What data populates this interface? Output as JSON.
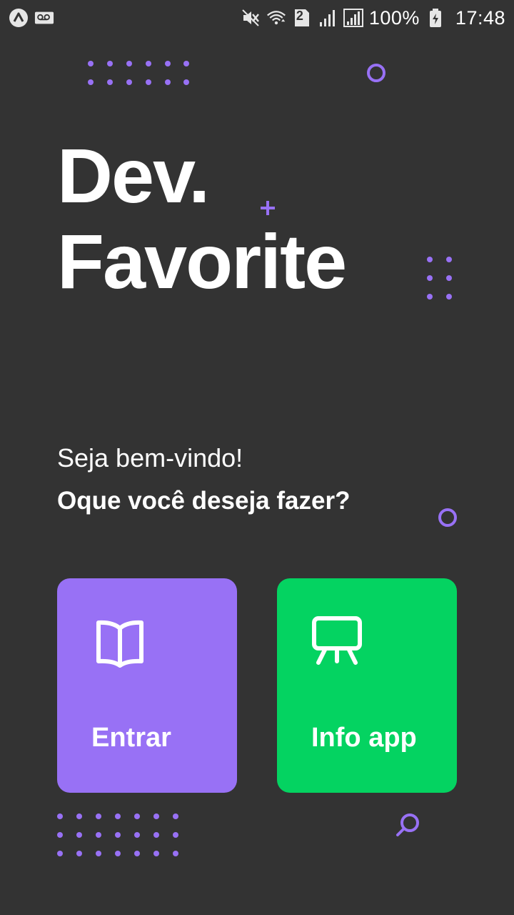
{
  "statusbar": {
    "icons": [
      "app-logo-icon",
      "voicemail-icon",
      "mute-icon",
      "wifi-icon",
      "sim-2-icon",
      "signal-icon",
      "signal-icon",
      "battery-charging-icon"
    ],
    "sim_badge": "2",
    "battery": "100%",
    "time": "17:48"
  },
  "hero": {
    "title_line1": "Dev.",
    "title_line2": "Favorite"
  },
  "welcome": {
    "greeting": "Seja bem-vindo!",
    "question": "Oque você deseja fazer?"
  },
  "actions": {
    "enter": {
      "label": "Entrar",
      "icon": "open-book-icon"
    },
    "info": {
      "label": "Info app",
      "icon": "presentation-board-icon"
    }
  },
  "colors": {
    "background": "#333333",
    "accent_purple": "#9871f5",
    "accent_green": "#04d361",
    "text": "#ffffff"
  }
}
